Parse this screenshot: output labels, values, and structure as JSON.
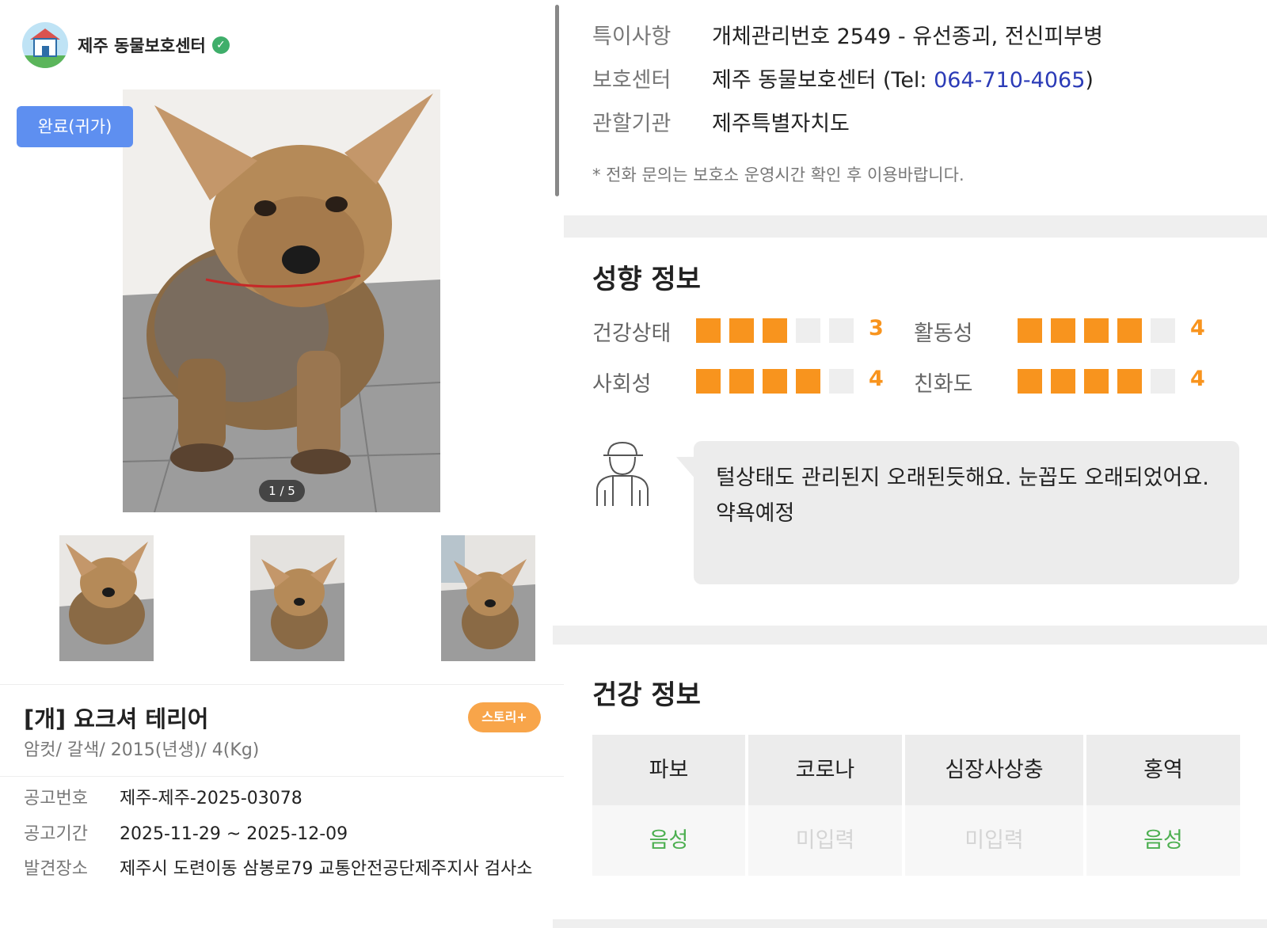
{
  "shelter": {
    "name": "제주 동물보호센터",
    "verified_icon": "check-badge-icon"
  },
  "photo": {
    "status_badge": "완료(귀가)",
    "counter": "1 / 5",
    "thumbnail_count": 3
  },
  "animal": {
    "title": "[개] 요크셔 테리어",
    "story_button": "스토리+",
    "subtitle": "암컷/ 갈색/ 2015(년생)/ 4(Kg)"
  },
  "details": {
    "notice_no_label": "공고번호",
    "notice_no": "제주-제주-2025-03078",
    "period_label": "공고기간",
    "period": "2025-11-29 ~ 2025-12-09",
    "found_label": "발견장소",
    "found_place": "제주시 도련이동 삼봉로79 교통안전공단제주지사 검사소"
  },
  "right_info": {
    "special_label": "특이사항",
    "special_value": "개체관리번호 2549 - 유선종괴, 전신피부병",
    "center_label": "보호센터",
    "center_value_prefix": "제주 동물보호센터 (Tel: ",
    "center_phone": "064-710-4065",
    "center_value_suffix": ")",
    "authority_label": "관할기관",
    "authority_value": "제주특별자치도",
    "note": "* 전화 문의는 보호소 운영시간 확인 후 이용바랍니다."
  },
  "personality": {
    "title": "성향 정보",
    "max_score": 5,
    "traits": [
      {
        "label": "건강상태",
        "score": 3
      },
      {
        "label": "활동성",
        "score": 4
      },
      {
        "label": "사회성",
        "score": 4
      },
      {
        "label": "친화도",
        "score": 4
      }
    ],
    "comment": "털상태도 관리된지 오래된듯해요. 눈꼽도 오래되었어요. 약욕예정",
    "staff_icon": "staff-person-icon"
  },
  "health": {
    "title": "건강 정보",
    "columns": [
      "파보",
      "코로나",
      "심장사상충",
      "홍역"
    ],
    "values": [
      "음성",
      "미입력",
      "미입력",
      "음성"
    ]
  },
  "colors": {
    "accent_orange": "#f8941e",
    "badge_blue": "#5e8ff0",
    "phone_blue": "#2b3bb7",
    "negative_green": "#4caf50"
  }
}
